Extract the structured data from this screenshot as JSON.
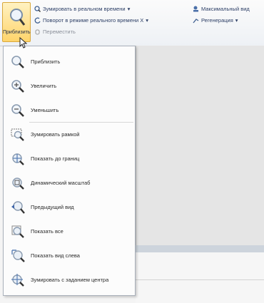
{
  "ribbon": {
    "zoom_button_label": "Приблизить",
    "zoom_realtime": "Зумировать в реальном времени",
    "rotate_realtime": "Поворот в режиме реального времени X",
    "move": "Переместить",
    "max_view": "Максимальный вид",
    "regeneration": "Регенерация",
    "dropdown_marker": "▾"
  },
  "menu": {
    "items": [
      {
        "label": "Приблизить",
        "icon": "magnifier-icon"
      },
      {
        "label": "Увеличить",
        "icon": "zoom-in-icon"
      },
      {
        "label": "Уменьшить",
        "icon": "zoom-out-icon"
      },
      {
        "label": "Зумировать рамкой",
        "icon": "zoom-window-icon"
      },
      {
        "label": "Показать до границ",
        "icon": "zoom-extents-icon"
      },
      {
        "label": "Динамический масштаб",
        "icon": "dynamic-zoom-icon"
      },
      {
        "label": "Предыдущий вид",
        "icon": "previous-view-icon"
      },
      {
        "label": "Показать все",
        "icon": "zoom-all-icon"
      },
      {
        "label": "Показать вид слева",
        "icon": "zoom-left-icon"
      },
      {
        "label": "Зумировать с заданием центра",
        "icon": "zoom-center-icon"
      }
    ]
  },
  "colors": {
    "accent_active": "#ffd46b",
    "icon_blue": "#5a7fb5"
  }
}
